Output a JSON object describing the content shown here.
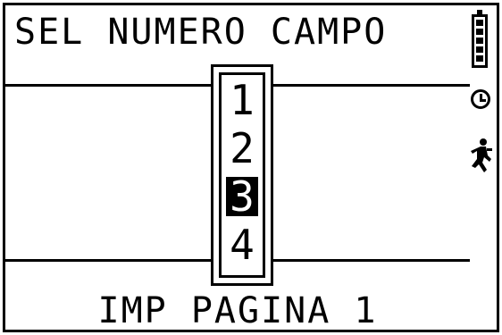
{
  "header": {
    "title": "SEL NUMERO CAMPO"
  },
  "status": {
    "battery_icon": "battery-icon",
    "clock_icon": "clock-icon",
    "runner_icon": "runner-icon"
  },
  "picker": {
    "options": [
      "1",
      "2",
      "3",
      "4"
    ],
    "selected": "3"
  },
  "footer": {
    "text": "IMP PAGINA 1"
  },
  "colors": {
    "foreground": "#000000",
    "background": "#ffffff"
  }
}
